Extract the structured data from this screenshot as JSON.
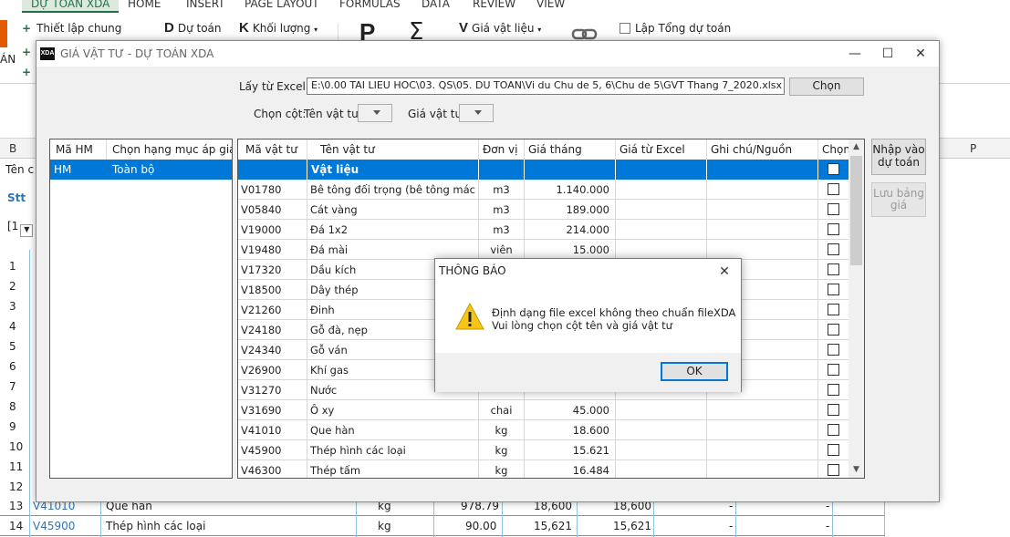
{
  "excel": {
    "tabs": [
      "DỰ TOÁN XDA",
      "HOME",
      "INSERT",
      "PAGE LAYOUT",
      "FORMULAS",
      "DATA",
      "REVIEW",
      "VIEW"
    ],
    "ribbon": {
      "thiet_lap_chung": "Thiết lập chung",
      "du_toan": "Dự toán",
      "khoi_luong": "Khối lượng",
      "gia_vat_lieu": "Giá vật liệu",
      "lap_tong_du_toan": "Lập Tổng dự toán",
      "an_label": "ÁN"
    },
    "col_headers": [
      "B",
      "P"
    ],
    "left_labels": [
      "Tên c",
      "Stt",
      "[1"
    ],
    "row_numbers": [
      "1",
      "2",
      "3",
      "4",
      "5",
      "6",
      "7",
      "8",
      "9",
      "10",
      "11",
      "12",
      "13",
      "14"
    ],
    "visible_rows": [
      {
        "num": "13",
        "code": "V41010",
        "name": "Que hàn",
        "unit": "kg",
        "qty": "978.79",
        "p1": "18,600",
        "p2": "18,600",
        "d1": "-",
        "d2": "-"
      },
      {
        "num": "14",
        "code": "V45900",
        "name": "Thép hình các loại",
        "unit": "kg",
        "qty": "90.00",
        "p1": "15,621",
        "p2": "15,621",
        "d1": "-",
        "d2": "-"
      }
    ]
  },
  "dialog": {
    "title": "GIÁ VẬT TƯ - DỰ TOÁN XDA",
    "logo": "XDA",
    "excel_label": "Lấy từ Excel:",
    "excel_path": "E:\\0.00 TAI LIEU HOC\\03. QS\\05. DU TOAN\\Vi du Chu de 5, 6\\Chu de 5\\GVT Thang 7_2020.xlsx",
    "choose_button": "Chọn",
    "choose_col_label": "Chọn cột:",
    "material_name_label": "Tên vật tư:",
    "material_price_label": "Giá vật tư:",
    "import_button": "Nhập vào dự toán",
    "save_button": "Lưu bảng giá",
    "left_grid": {
      "headers": [
        "Mã HM",
        "Chọn hạng mục áp giá"
      ],
      "rows": [
        {
          "code": "HM",
          "name": "Toàn bộ"
        }
      ]
    },
    "right_grid": {
      "headers": [
        "Mã vật tư",
        "Tên vật tư",
        "Đơn vị",
        "Giá tháng",
        "Giá từ Excel",
        "Ghi chú/Nguồn",
        "Chọn"
      ],
      "group_row": "Vật liệu",
      "rows": [
        {
          "code": "V01780",
          "name": "Bê tông đối trọng (bê tông mác 200 ...",
          "unit": "m3",
          "price": "1.140.000"
        },
        {
          "code": "V05840",
          "name": "Cát vàng",
          "unit": "m3",
          "price": "189.000"
        },
        {
          "code": "V19000",
          "name": "Đá 1x2",
          "unit": "m3",
          "price": "214.000"
        },
        {
          "code": "V19480",
          "name": "Đá mài",
          "unit": "viên",
          "price": "15.000"
        },
        {
          "code": "V17320",
          "name": "Dầu kích",
          "unit": "",
          "price": ""
        },
        {
          "code": "V18500",
          "name": "Dây thép",
          "unit": "",
          "price": ""
        },
        {
          "code": "V21260",
          "name": "Đinh",
          "unit": "",
          "price": ""
        },
        {
          "code": "V24180",
          "name": "Gỗ đà, nẹp",
          "unit": "",
          "price": ""
        },
        {
          "code": "V24340",
          "name": "Gỗ ván",
          "unit": "",
          "price": ""
        },
        {
          "code": "V26900",
          "name": "Khí gas",
          "unit": "",
          "price": ""
        },
        {
          "code": "V31270",
          "name": "Nước",
          "unit": "",
          "price": ""
        },
        {
          "code": "V31690",
          "name": "Ô xy",
          "unit": "chai",
          "price": "45.000"
        },
        {
          "code": "V41010",
          "name": "Que hàn",
          "unit": "kg",
          "price": "18.600"
        },
        {
          "code": "V45900",
          "name": "Thép hình các loại",
          "unit": "kg",
          "price": "15.621"
        },
        {
          "code": "V46300",
          "name": "Thép tấm",
          "unit": "kg",
          "price": "16.484"
        }
      ]
    }
  },
  "msgbox": {
    "title": "THÔNG BÁO",
    "line1": "Định dạng file excel không theo chuẩn fileXDA",
    "line2": "Vui lòng chọn cột tên và giá vật tư",
    "ok_button": "OK"
  },
  "colors": {
    "accent": "#0078d7",
    "excel_green": "#217346",
    "link_blue": "#2e75b6"
  }
}
